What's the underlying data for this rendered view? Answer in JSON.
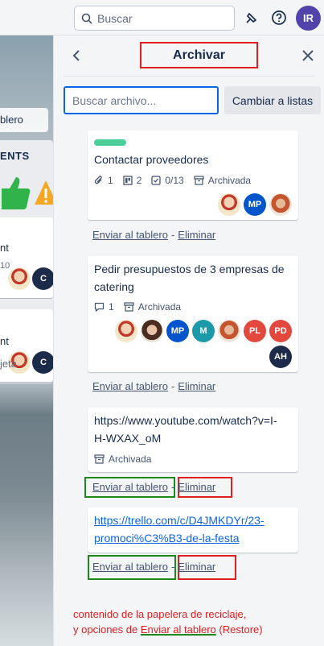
{
  "topbar": {
    "search_placeholder": "Buscar",
    "avatar_initials": "IR"
  },
  "board": {
    "button_label": "blero",
    "list_heading": "ENTS",
    "card1_text": "nt",
    "card1_sub": "10",
    "card1_avatar_initial": "C",
    "card2_text": "nt",
    "card2_avatar_initial": "C",
    "add_card_label": "jeta"
  },
  "panel": {
    "title": "Archivar",
    "search_placeholder": "Buscar archivo...",
    "switch_button": "Cambiar a listas",
    "cards": [
      {
        "title": "Contactar proveedores",
        "attachments": "1",
        "comments_board": "2",
        "checklist": "0/13",
        "status": "Archivada",
        "members": [
          "photo",
          "MP",
          "photo"
        ]
      },
      {
        "title_line1": "Pedir presupuestos de 3 empresas de",
        "title_line2": "catering",
        "comments": "1",
        "status": "Archivada",
        "members": [
          "photo",
          "photo",
          "MP",
          "M",
          "photo",
          "PL",
          "PD",
          "AH"
        ]
      },
      {
        "title_line1": "https://www.youtube.com/watch?v=I-",
        "title_line2": "H-WXAX_oM",
        "status": "Archivada"
      },
      {
        "title_line1": "https://trello.com/c/D4JMKDYr/23-",
        "title_line2": "promoci%C3%B3-de-la-festa"
      }
    ],
    "send_to_board": "Enviar al tablero",
    "separator": "-",
    "delete": "Eliminar"
  },
  "annotation": {
    "line1": "contenido de la papelera de reciclaje,",
    "line2_prefix": "y opciones de ",
    "line2_highlight": "Enviar al tablero",
    "line2_suffix": " (Restore)"
  },
  "colors": {
    "accent": "#0c66e4",
    "label_green": "#4bce97",
    "annotation_red": "#e02020",
    "annotation_green": "#1b8a1b",
    "mp": "#0055cc",
    "m": "#1d9aaa",
    "pl": "#e2483d",
    "pd": "#e2483d",
    "ah": "#1d2b4a",
    "ir": "#5243aa"
  }
}
